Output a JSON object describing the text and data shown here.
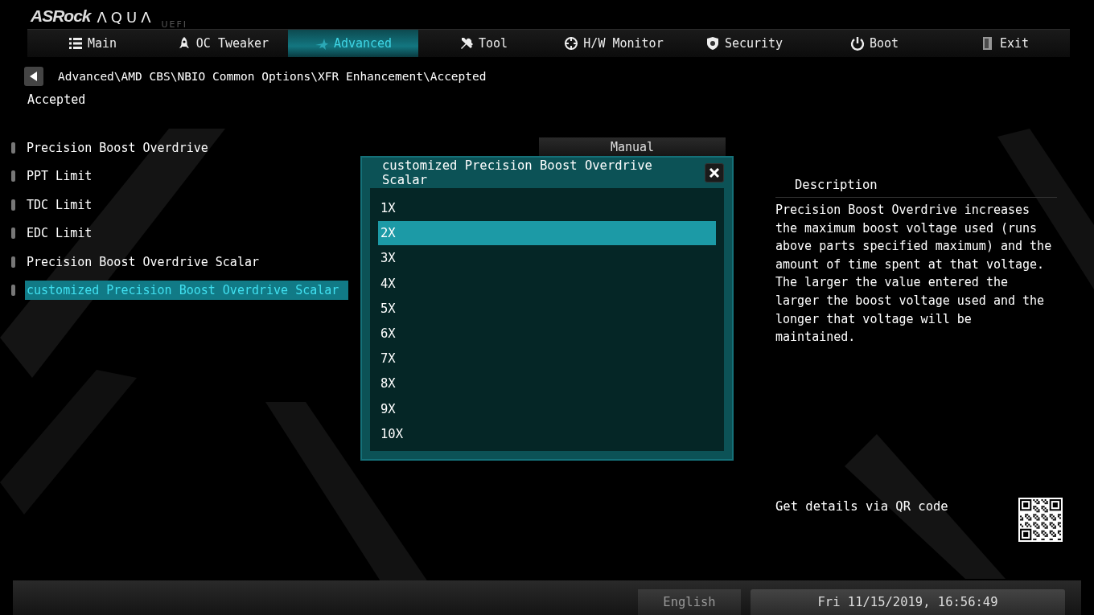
{
  "logo": {
    "brand": "ASRock",
    "product": "ΛQUΛ",
    "suffix": "UEFI"
  },
  "tabs": [
    {
      "label": "Main",
      "selected": false
    },
    {
      "label": "OC Tweaker",
      "selected": false
    },
    {
      "label": "Advanced",
      "selected": true
    },
    {
      "label": "Tool",
      "selected": false
    },
    {
      "label": "H/W Monitor",
      "selected": false
    },
    {
      "label": "Security",
      "selected": false
    },
    {
      "label": "Boot",
      "selected": false
    },
    {
      "label": "Exit",
      "selected": false
    }
  ],
  "breadcrumb": "Advanced\\AMD CBS\\NBIO Common Options\\XFR Enhancement\\Accepted",
  "section_title": "Accepted",
  "settings": [
    {
      "label": "Precision Boost Overdrive",
      "value": "Manual",
      "selected": false
    },
    {
      "label": "PPT Limit",
      "selected": false
    },
    {
      "label": "TDC Limit",
      "selected": false
    },
    {
      "label": "EDC Limit",
      "selected": false
    },
    {
      "label": "Precision Boost Overdrive Scalar",
      "selected": false
    },
    {
      "label": "customized Precision Boost Overdrive Scalar",
      "selected": true
    }
  ],
  "dialog": {
    "title": "customized Precision Boost Overdrive Scalar",
    "options": [
      {
        "label": "1X",
        "selected": false
      },
      {
        "label": "2X",
        "selected": true
      },
      {
        "label": "3X",
        "selected": false
      },
      {
        "label": "4X",
        "selected": false
      },
      {
        "label": "5X",
        "selected": false
      },
      {
        "label": "6X",
        "selected": false
      },
      {
        "label": "7X",
        "selected": false
      },
      {
        "label": "8X",
        "selected": false
      },
      {
        "label": "9X",
        "selected": false
      },
      {
        "label": "10X",
        "selected": false
      }
    ]
  },
  "description": {
    "title": "Description",
    "text": "Precision Boost Overdrive increases the maximum boost voltage used (runs above parts specified maximum) and the amount of time spent at that voltage. The larger the value entered the larger the boost voltage used and the longer that voltage will be maintained."
  },
  "qr_hint": "Get details via QR code",
  "status_bar": {
    "language": "English",
    "datetime": "Fri 11/15/2019, 16:56:49"
  }
}
